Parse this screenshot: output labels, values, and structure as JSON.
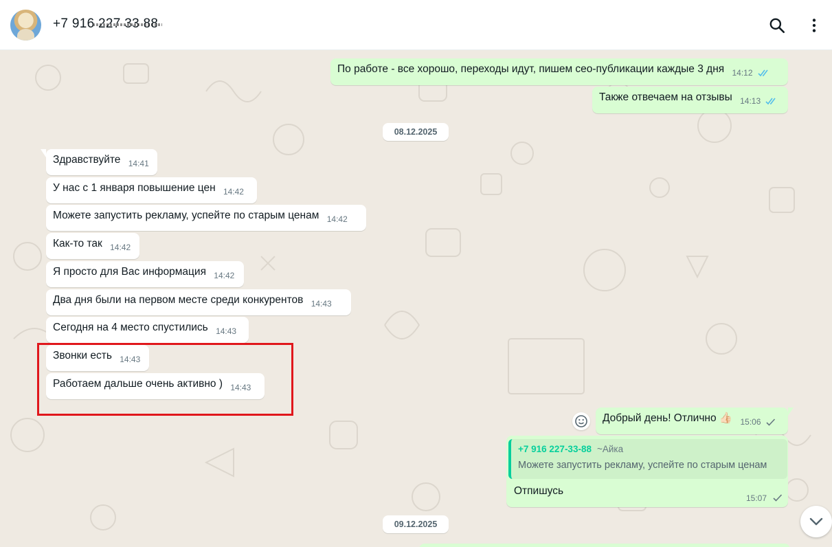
{
  "header": {
    "contact_name": "+7 916 227 33 88",
    "search_icon": "search-icon",
    "menu_icon": "more-vertical-icon"
  },
  "colors": {
    "incoming_bubble": "#ffffff",
    "outgoing_bubble": "#d9fdd3",
    "chat_background": "#efeae2",
    "read_ticks": "#53bdeb",
    "quote_accent": "#06cf9c",
    "highlight_frame": "#e0171c"
  },
  "messages_top": [
    {
      "text": "По работе - все хорошо, переходы идут, пишем сео-публикации каждые 3 дня",
      "time": "14:12",
      "status": "read"
    },
    {
      "text": "Также отвечаем на отзывы",
      "time": "14:13",
      "status": "read"
    }
  ],
  "date_1": "08.12.2025",
  "incoming": [
    {
      "text": "Здравствуйте",
      "time": "14:41"
    },
    {
      "text": "У нас с 1 января повышение цен",
      "time": "14:42"
    },
    {
      "text": "Можете запустить рекламу, успейте по старым ценам",
      "time": "14:42"
    },
    {
      "text": "Как-то так",
      "time": "14:42"
    },
    {
      "text": "Я просто для Вас информация",
      "time": "14:42"
    },
    {
      "text": "Два дня были на первом месте среди конкурентов",
      "time": "14:43"
    },
    {
      "text": "Сегодня на 4 место спустились",
      "time": "14:43"
    },
    {
      "text": "Звонки есть",
      "time": "14:43"
    },
    {
      "text": "Работаем дальше очень активно )",
      "time": "14:43"
    }
  ],
  "outgoing_reply": {
    "text": "Добрый день! Отлично 👍🏻",
    "time": "15:06",
    "status": "sent"
  },
  "quoted_reply": {
    "quote_author": "+7 916 227-33-88",
    "quote_alias": "~Айка",
    "quote_text": "Можете запустить рекламу, успейте по старым ценам",
    "text": "Отпишусь",
    "time": "15:07",
    "status": "sent"
  },
  "date_2": "09.12.2025"
}
